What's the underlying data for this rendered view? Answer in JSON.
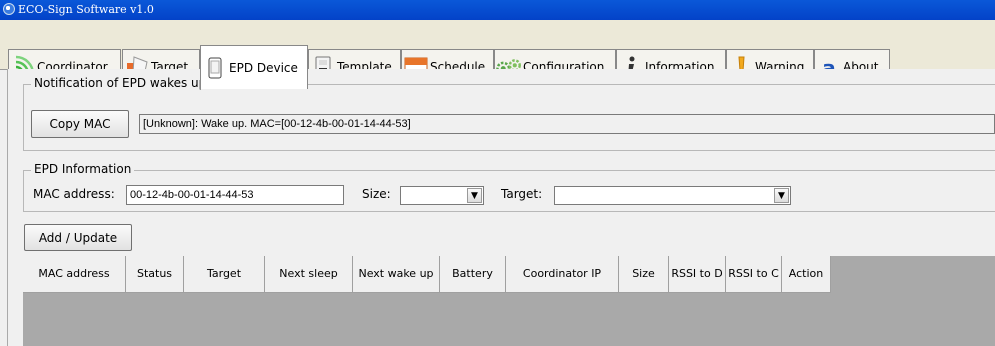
{
  "window": {
    "title": "ECO-Sign Software v1.0"
  },
  "tabs": [
    {
      "label": "Coordinator",
      "icon": "signal-icon"
    },
    {
      "label": "Target",
      "icon": "target-icon"
    },
    {
      "label": "EPD Device",
      "icon": "epd-device-icon"
    },
    {
      "label": "Template",
      "icon": "template-icon"
    },
    {
      "label": "Schedule",
      "icon": "calendar-icon"
    },
    {
      "label": "Configuration",
      "icon": "gears-icon"
    },
    {
      "label": "Information",
      "icon": "info-icon"
    },
    {
      "label": "Warning",
      "icon": "warning-icon"
    },
    {
      "label": "About",
      "icon": "about-icon"
    }
  ],
  "active_tab": "EPD Device",
  "notification": {
    "legend": "Notification of EPD wakes up",
    "copy_button": "Copy MAC",
    "message": "[Unknown]: Wake up. MAC=[00-12-4b-00-01-14-44-53]"
  },
  "epd_info": {
    "legend": "EPD Information",
    "mac_label": "MAC address:",
    "mac_value": "00-12-4b-00-01-14-44-53",
    "size_label": "Size:",
    "size_value": "",
    "target_label": "Target:",
    "target_value": ""
  },
  "add_update_button": "Add / Update",
  "table": {
    "columns": [
      "MAC address",
      "Status",
      "Target",
      "Next sleep",
      "Next wake up",
      "Battery",
      "Coordinator IP",
      "Size",
      "RSSI to D",
      "RSSI to C",
      "Action"
    ],
    "rows": []
  },
  "colors": {
    "titlebar": "#0a58d8",
    "grid_background": "#a9a9a9"
  }
}
